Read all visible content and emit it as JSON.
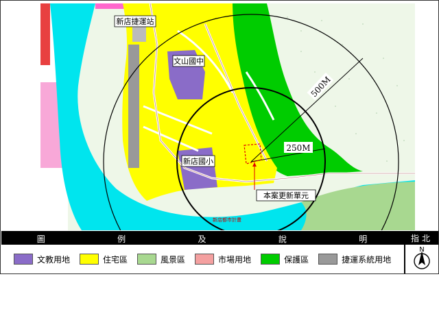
{
  "map": {
    "labels": {
      "station": "新店捷運站",
      "school_wenshan": "文山國中",
      "school_xindian": "新店國小",
      "radius_500": "500M",
      "radius_250": "250M",
      "site": "本案更新單元",
      "footer_small": "新店都市計畫"
    }
  },
  "legend": {
    "title_chars": [
      "圖",
      "例",
      "及",
      "說",
      "明"
    ],
    "north_title": "指北",
    "items": [
      {
        "label": "文教用地",
        "color": "#8a6cc8"
      },
      {
        "label": "住宅區",
        "color": "#ffff00"
      },
      {
        "label": "風景區",
        "color": "#a8d890"
      },
      {
        "label": "市場用地",
        "color": "#f4a0a0"
      },
      {
        "label": "保護區",
        "color": "#00cc00"
      },
      {
        "label": "捷運系統用地",
        "color": "#999999"
      }
    ]
  },
  "north_arrow": {
    "letter": "N"
  },
  "colors": {
    "river": "#00e5ee",
    "residential": "#ffff00",
    "protection": "#00cc00",
    "school": "#8a6cc8",
    "scenic": "#a8d890",
    "market": "#f4a0a0",
    "mrt": "#999999",
    "magenta": "#ff66cc",
    "stipple": "#e8f4e0"
  }
}
